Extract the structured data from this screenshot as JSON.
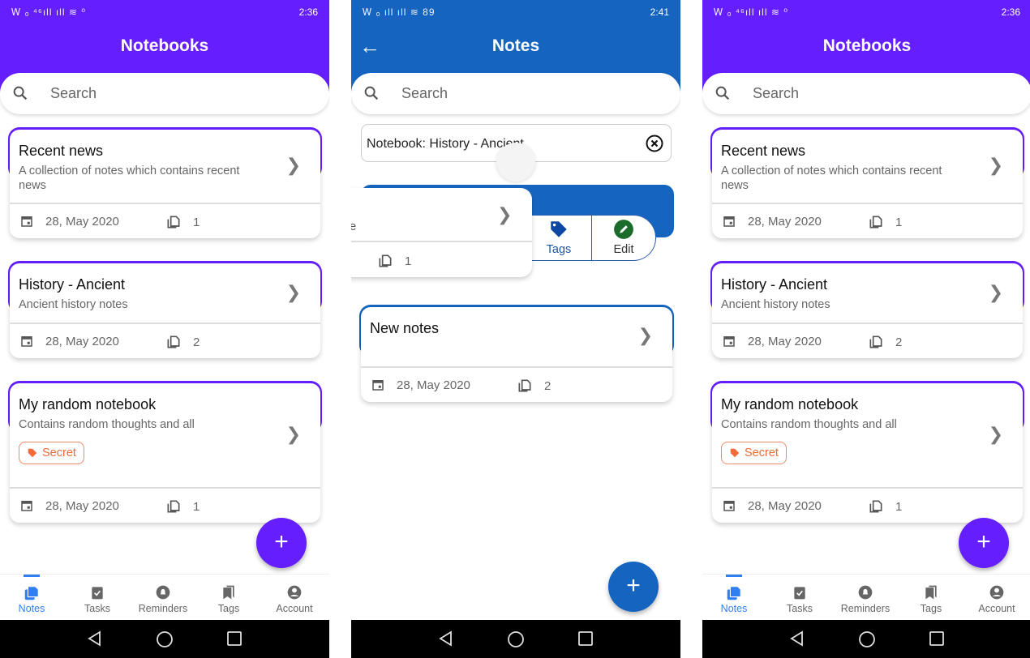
{
  "colors": {
    "purple": "#651fff",
    "blue": "#1565c0",
    "tag": "#f06a3a",
    "edit_green": "#1b6b2a"
  },
  "left": {
    "status": {
      "left": "Ꮃ ₒ ⁴⁶ıll ıll ≋ ⁰",
      "time": "2:36"
    },
    "title": "Notebooks",
    "search_placeholder": "Search",
    "cards": [
      {
        "title": "Recent news",
        "desc": "A collection of notes which contains recent news",
        "date": "28, May 2020",
        "count": "1"
      },
      {
        "title": "History - Ancient",
        "desc": "Ancient history notes",
        "date": "28, May 2020",
        "count": "2"
      },
      {
        "title": "My random notebook",
        "desc": "Contains random thoughts and all",
        "tag": "Secret",
        "date": "28, May 2020",
        "count": "1"
      }
    ],
    "fab": "+",
    "nav": [
      {
        "label": "Notes",
        "icon": "notes-icon",
        "active": true
      },
      {
        "label": "Tasks",
        "icon": "tasks-icon"
      },
      {
        "label": "Reminders",
        "icon": "bell-icon"
      },
      {
        "label": "Tags",
        "icon": "bookmarks-icon"
      },
      {
        "label": "Account",
        "icon": "account-icon"
      }
    ]
  },
  "middle": {
    "status": {
      "left": "Ꮃ ₒ ıll ıll ≋ 89",
      "time": "2:41"
    },
    "title": "Notes",
    "search_placeholder": "Search",
    "filter_chip": "Notebook: History - Ancient",
    "swiped_card": {
      "desc_fragment": "ge",
      "count": "1"
    },
    "actions": {
      "tags": "Tags",
      "edit": "Edit"
    },
    "card": {
      "title": "New notes",
      "date": "28, May 2020",
      "count": "2"
    },
    "fab": "+"
  },
  "right": {
    "status": {
      "left": "Ꮃ ₒ ⁴⁶ıll ıll ≋ ⁰",
      "time": "2:36"
    },
    "title": "Notebooks",
    "search_placeholder": "Search",
    "cards": [
      {
        "title": "Recent news",
        "desc": "A collection of notes which contains recent news",
        "date": "28, May 2020",
        "count": "1"
      },
      {
        "title": "History - Ancient",
        "desc": "Ancient history notes",
        "date": "28, May 2020",
        "count": "2"
      },
      {
        "title": "My random notebook",
        "desc": "Contains random thoughts and all",
        "tag": "Secret",
        "date": "28, May 2020",
        "count": "1"
      }
    ],
    "fab": "+",
    "nav": [
      {
        "label": "Notes",
        "icon": "notes-icon",
        "active": true
      },
      {
        "label": "Tasks",
        "icon": "tasks-icon"
      },
      {
        "label": "Reminders",
        "icon": "bell-icon"
      },
      {
        "label": "Tags",
        "icon": "bookmarks-icon"
      },
      {
        "label": "Account",
        "icon": "account-icon"
      }
    ]
  }
}
